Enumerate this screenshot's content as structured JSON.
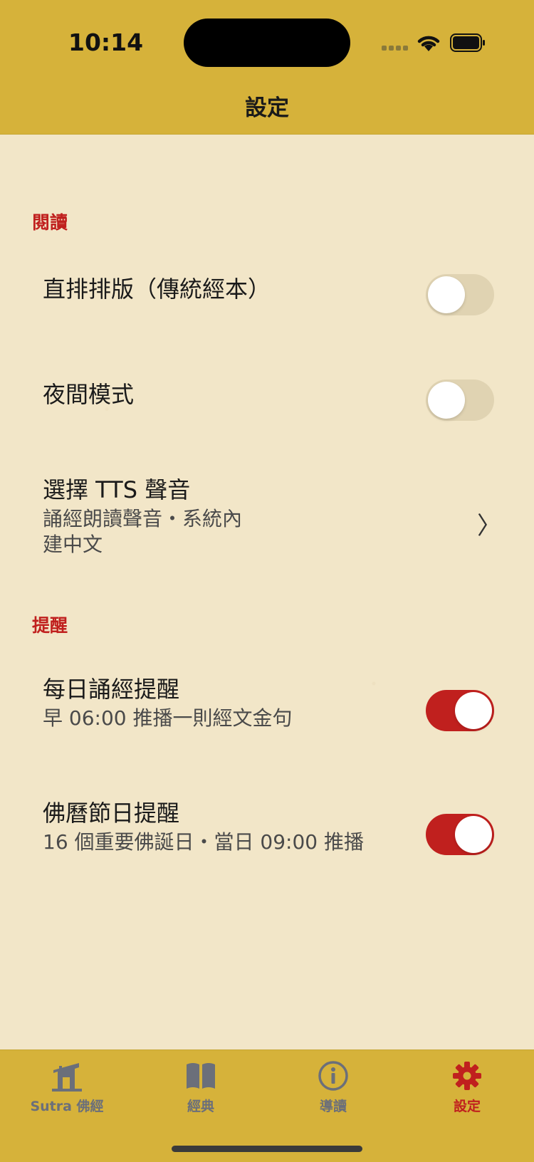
{
  "status_bar": {
    "time": "10:14"
  },
  "nav": {
    "title": "設定"
  },
  "sections": [
    {
      "header": "閱讀",
      "rows": [
        {
          "title": "直排排版（傳統經本）",
          "toggle": false
        },
        {
          "title": "夜間模式",
          "toggle": false
        },
        {
          "title": "選擇 TTS 聲音",
          "subtitle_line1": "誦經朗讀聲音・系統內",
          "subtitle_line2": "建中文",
          "chevron": "〉"
        }
      ]
    },
    {
      "header": "提醒",
      "rows": [
        {
          "title": "每日誦經提醒",
          "subtitle": "早 06:00 推播一則經文金句",
          "toggle": true
        },
        {
          "title": "佛曆節日提醒",
          "subtitle": "16 個重要佛誕日・當日 09:00 推播",
          "toggle": true
        }
      ]
    }
  ],
  "tabs": [
    {
      "label": "Sutra 佛經",
      "icon": "temple-icon"
    },
    {
      "label": "經典",
      "icon": "book-icon"
    },
    {
      "label": "導讀",
      "icon": "info-icon"
    },
    {
      "label": "設定",
      "icon": "gear-icon",
      "active": true
    }
  ],
  "colors": {
    "accent": "#c0201e",
    "bar": "#d6b23a",
    "paper": "#f2e6c8"
  }
}
